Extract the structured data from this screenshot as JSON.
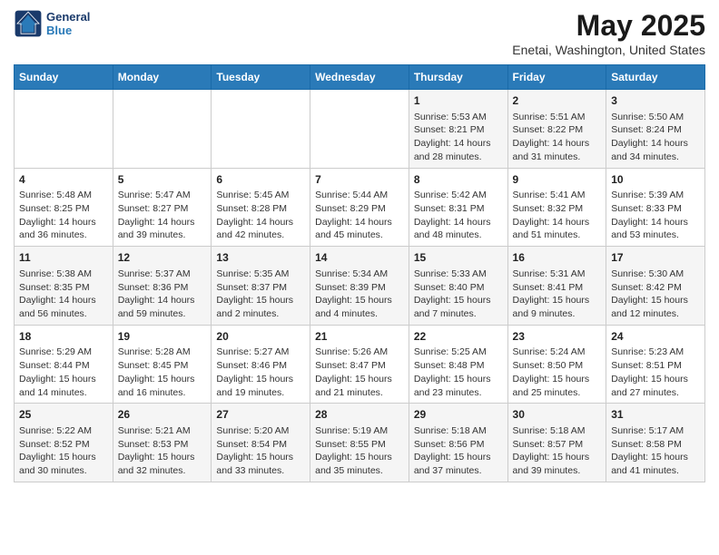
{
  "logo": {
    "line1": "General",
    "line2": "Blue"
  },
  "title": "May 2025",
  "subtitle": "Enetai, Washington, United States",
  "days_of_week": [
    "Sunday",
    "Monday",
    "Tuesday",
    "Wednesday",
    "Thursday",
    "Friday",
    "Saturday"
  ],
  "weeks": [
    [
      {
        "num": "",
        "info": ""
      },
      {
        "num": "",
        "info": ""
      },
      {
        "num": "",
        "info": ""
      },
      {
        "num": "",
        "info": ""
      },
      {
        "num": "1",
        "info": "Sunrise: 5:53 AM\nSunset: 8:21 PM\nDaylight: 14 hours\nand 28 minutes."
      },
      {
        "num": "2",
        "info": "Sunrise: 5:51 AM\nSunset: 8:22 PM\nDaylight: 14 hours\nand 31 minutes."
      },
      {
        "num": "3",
        "info": "Sunrise: 5:50 AM\nSunset: 8:24 PM\nDaylight: 14 hours\nand 34 minutes."
      }
    ],
    [
      {
        "num": "4",
        "info": "Sunrise: 5:48 AM\nSunset: 8:25 PM\nDaylight: 14 hours\nand 36 minutes."
      },
      {
        "num": "5",
        "info": "Sunrise: 5:47 AM\nSunset: 8:27 PM\nDaylight: 14 hours\nand 39 minutes."
      },
      {
        "num": "6",
        "info": "Sunrise: 5:45 AM\nSunset: 8:28 PM\nDaylight: 14 hours\nand 42 minutes."
      },
      {
        "num": "7",
        "info": "Sunrise: 5:44 AM\nSunset: 8:29 PM\nDaylight: 14 hours\nand 45 minutes."
      },
      {
        "num": "8",
        "info": "Sunrise: 5:42 AM\nSunset: 8:31 PM\nDaylight: 14 hours\nand 48 minutes."
      },
      {
        "num": "9",
        "info": "Sunrise: 5:41 AM\nSunset: 8:32 PM\nDaylight: 14 hours\nand 51 minutes."
      },
      {
        "num": "10",
        "info": "Sunrise: 5:39 AM\nSunset: 8:33 PM\nDaylight: 14 hours\nand 53 minutes."
      }
    ],
    [
      {
        "num": "11",
        "info": "Sunrise: 5:38 AM\nSunset: 8:35 PM\nDaylight: 14 hours\nand 56 minutes."
      },
      {
        "num": "12",
        "info": "Sunrise: 5:37 AM\nSunset: 8:36 PM\nDaylight: 14 hours\nand 59 minutes."
      },
      {
        "num": "13",
        "info": "Sunrise: 5:35 AM\nSunset: 8:37 PM\nDaylight: 15 hours\nand 2 minutes."
      },
      {
        "num": "14",
        "info": "Sunrise: 5:34 AM\nSunset: 8:39 PM\nDaylight: 15 hours\nand 4 minutes."
      },
      {
        "num": "15",
        "info": "Sunrise: 5:33 AM\nSunset: 8:40 PM\nDaylight: 15 hours\nand 7 minutes."
      },
      {
        "num": "16",
        "info": "Sunrise: 5:31 AM\nSunset: 8:41 PM\nDaylight: 15 hours\nand 9 minutes."
      },
      {
        "num": "17",
        "info": "Sunrise: 5:30 AM\nSunset: 8:42 PM\nDaylight: 15 hours\nand 12 minutes."
      }
    ],
    [
      {
        "num": "18",
        "info": "Sunrise: 5:29 AM\nSunset: 8:44 PM\nDaylight: 15 hours\nand 14 minutes."
      },
      {
        "num": "19",
        "info": "Sunrise: 5:28 AM\nSunset: 8:45 PM\nDaylight: 15 hours\nand 16 minutes."
      },
      {
        "num": "20",
        "info": "Sunrise: 5:27 AM\nSunset: 8:46 PM\nDaylight: 15 hours\nand 19 minutes."
      },
      {
        "num": "21",
        "info": "Sunrise: 5:26 AM\nSunset: 8:47 PM\nDaylight: 15 hours\nand 21 minutes."
      },
      {
        "num": "22",
        "info": "Sunrise: 5:25 AM\nSunset: 8:48 PM\nDaylight: 15 hours\nand 23 minutes."
      },
      {
        "num": "23",
        "info": "Sunrise: 5:24 AM\nSunset: 8:50 PM\nDaylight: 15 hours\nand 25 minutes."
      },
      {
        "num": "24",
        "info": "Sunrise: 5:23 AM\nSunset: 8:51 PM\nDaylight: 15 hours\nand 27 minutes."
      }
    ],
    [
      {
        "num": "25",
        "info": "Sunrise: 5:22 AM\nSunset: 8:52 PM\nDaylight: 15 hours\nand 30 minutes."
      },
      {
        "num": "26",
        "info": "Sunrise: 5:21 AM\nSunset: 8:53 PM\nDaylight: 15 hours\nand 32 minutes."
      },
      {
        "num": "27",
        "info": "Sunrise: 5:20 AM\nSunset: 8:54 PM\nDaylight: 15 hours\nand 33 minutes."
      },
      {
        "num": "28",
        "info": "Sunrise: 5:19 AM\nSunset: 8:55 PM\nDaylight: 15 hours\nand 35 minutes."
      },
      {
        "num": "29",
        "info": "Sunrise: 5:18 AM\nSunset: 8:56 PM\nDaylight: 15 hours\nand 37 minutes."
      },
      {
        "num": "30",
        "info": "Sunrise: 5:18 AM\nSunset: 8:57 PM\nDaylight: 15 hours\nand 39 minutes."
      },
      {
        "num": "31",
        "info": "Sunrise: 5:17 AM\nSunset: 8:58 PM\nDaylight: 15 hours\nand 41 minutes."
      }
    ]
  ]
}
